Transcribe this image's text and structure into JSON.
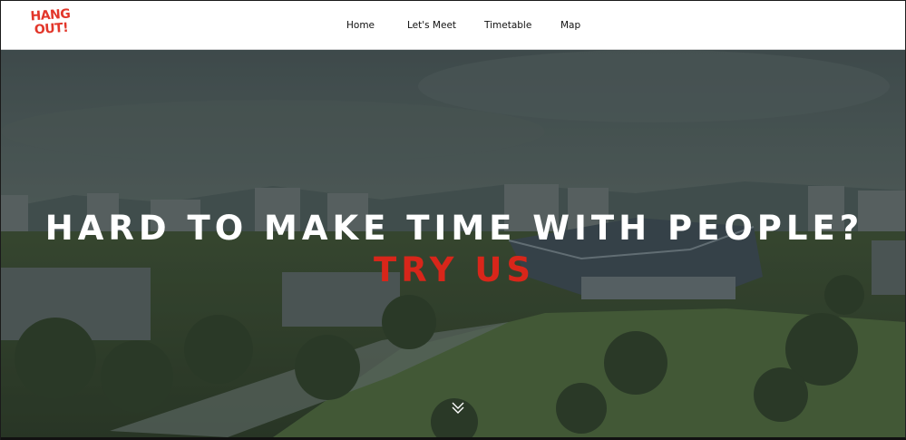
{
  "logo": {
    "line1": "HANG",
    "line2": "OUT!"
  },
  "nav": {
    "items": [
      {
        "label": "Home"
      },
      {
        "label": "Let's Meet"
      },
      {
        "label": "Timetable"
      },
      {
        "label": "Map"
      }
    ]
  },
  "hero": {
    "title": "HARD TO MAKE TIME WITH PEOPLE?",
    "cta": "TRY US",
    "scroll_icon": "chevron-double-down-icon"
  },
  "colors": {
    "brand_red": "#e2362a",
    "cta_red": "#d8261a",
    "nav_bg": "#ffffff",
    "hero_overlay": "#1f2a2f"
  }
}
